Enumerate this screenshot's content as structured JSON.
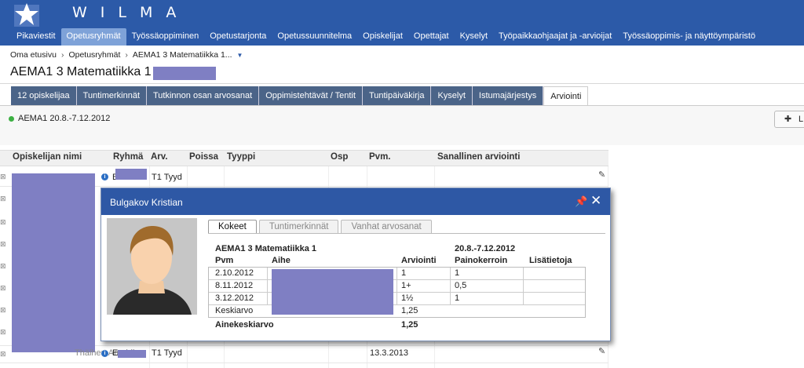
{
  "app": {
    "brand": "WILMA"
  },
  "nav": [
    {
      "label": "Pikaviestit",
      "active": false
    },
    {
      "label": "Opetusryhmät",
      "active": true
    },
    {
      "label": "Työssäoppiminen",
      "active": false
    },
    {
      "label": "Opetustarjonta",
      "active": false
    },
    {
      "label": "Opetussuunnitelma",
      "active": false
    },
    {
      "label": "Opiskelijat",
      "active": false
    },
    {
      "label": "Opettajat",
      "active": false
    },
    {
      "label": "Kyselyt",
      "active": false
    },
    {
      "label": "Työpaikkaohjaajat ja -arvioijat",
      "active": false
    },
    {
      "label": "Työssäoppimis- ja näyttöympäristö",
      "active": false
    }
  ],
  "breadcrumb": [
    "Oma etusivu",
    "Opetusryhmät",
    "AEMA1 3 Matematiikka 1..."
  ],
  "page_title": "AEMA1 3 Matematiikka 1",
  "subtabs": [
    {
      "label": "12 opiskelijaa",
      "active": false
    },
    {
      "label": "Tuntimerkinnät",
      "active": false
    },
    {
      "label": "Tutkinnon osan arvosanat",
      "active": false
    },
    {
      "label": "Oppimistehtävät / Tentit",
      "active": false
    },
    {
      "label": "Tuntipäiväkirja",
      "active": false
    },
    {
      "label": "Kyselyt",
      "active": false
    },
    {
      "label": "Istumajärjestys",
      "active": false
    },
    {
      "label": "Arviointi",
      "active": true
    }
  ],
  "course_period": "AEMA1 20.8.-7.12.2012",
  "side_button_label": "L",
  "table": {
    "headers": [
      "Opiskelijan nimi",
      "Ryhmä",
      "Arv.",
      "Poissa",
      "Tyyppi",
      "Osp",
      "Pvm.",
      "Sanallinen arviointi"
    ],
    "row_first": {
      "type": "T1 Tyyd",
      "group_prefix": "B"
    },
    "row_last": {
      "name_fragment": "Thälhert Amphika",
      "group_prefix": "E",
      "type": "T1 Tyyd",
      "date": "13.3.2013"
    }
  },
  "popup": {
    "title": "Bulgakov Kristian",
    "tabs": [
      {
        "label": "Kokeet",
        "active": true
      },
      {
        "label": "Tuntimerkinnät",
        "active": false
      },
      {
        "label": "Vanhat arvosanat",
        "active": false
      }
    ],
    "course": "AEMA1 3 Matematiikka 1",
    "period": "20.8.-7.12.2012",
    "headers": {
      "pvm": "Pvm",
      "aihe": "Aihe",
      "arviointi": "Arviointi",
      "painokerroin": "Painokerroin",
      "lisatietoja": "Lisätietoja"
    },
    "rows": [
      {
        "pvm": "2.10.2012",
        "arviointi": "1",
        "painokerroin": "1"
      },
      {
        "pvm": "8.11.2012",
        "arviointi": "1+",
        "painokerroin": "0,5"
      },
      {
        "pvm": "3.12.2012",
        "arviointi": "1½",
        "painokerroin": "1"
      }
    ],
    "average_label": "Keskiarvo",
    "average_value": "1,25",
    "course_average_label": "Ainekeskiarvo",
    "course_average_value": "1,25"
  },
  "colors": {
    "header_blue": "#2c5aa8",
    "active_tab": "#7ea2d8",
    "subtab_bg": "#4b6488",
    "redaction": "#7f7fc3",
    "status_green": "#3cb043"
  }
}
